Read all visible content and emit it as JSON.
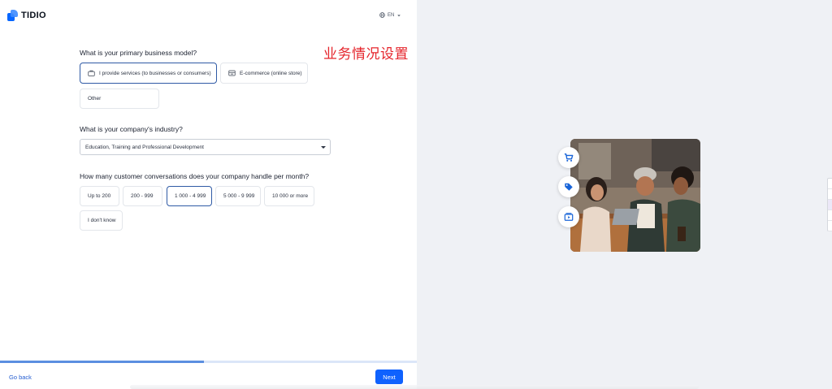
{
  "header": {
    "logo_text": "TIDIO",
    "language": "EN"
  },
  "annotation": "业务情况设置",
  "business_model": {
    "question": "What is your primary business model?",
    "options": [
      {
        "label": "I provide services (to businesses or consumers)",
        "icon": "briefcase-icon",
        "selected": true
      },
      {
        "label": "E-commerce (online store)",
        "icon": "storefront-icon",
        "selected": false
      },
      {
        "label": "Other",
        "selected": false
      }
    ]
  },
  "industry": {
    "question": "What is your company's industry?",
    "selected_value": "Education, Training and Professional Development"
  },
  "conversations": {
    "question": "How many customer conversations does your company handle per month?",
    "options": [
      {
        "label": "Up to 200",
        "selected": false
      },
      {
        "label": "200 - 999",
        "selected": false
      },
      {
        "label": "1 000 - 4 999",
        "selected": true
      },
      {
        "label": "5 000 - 9 999",
        "selected": false
      },
      {
        "label": "10 000 or more",
        "selected": false
      },
      {
        "label": "I don't know",
        "selected": false
      }
    ]
  },
  "progress": {
    "fraction": 0.49
  },
  "footer": {
    "back_label": "Go back",
    "next_label": "Next"
  },
  "side_badges": [
    "cart-icon",
    "tag-icon",
    "video-icon"
  ],
  "colors": {
    "primary": "#0f62fe",
    "link": "#2860d2",
    "selected_border": "#2f5aa5",
    "right_panel_bg": "#eff1f5",
    "annotation": "#e5242b"
  }
}
